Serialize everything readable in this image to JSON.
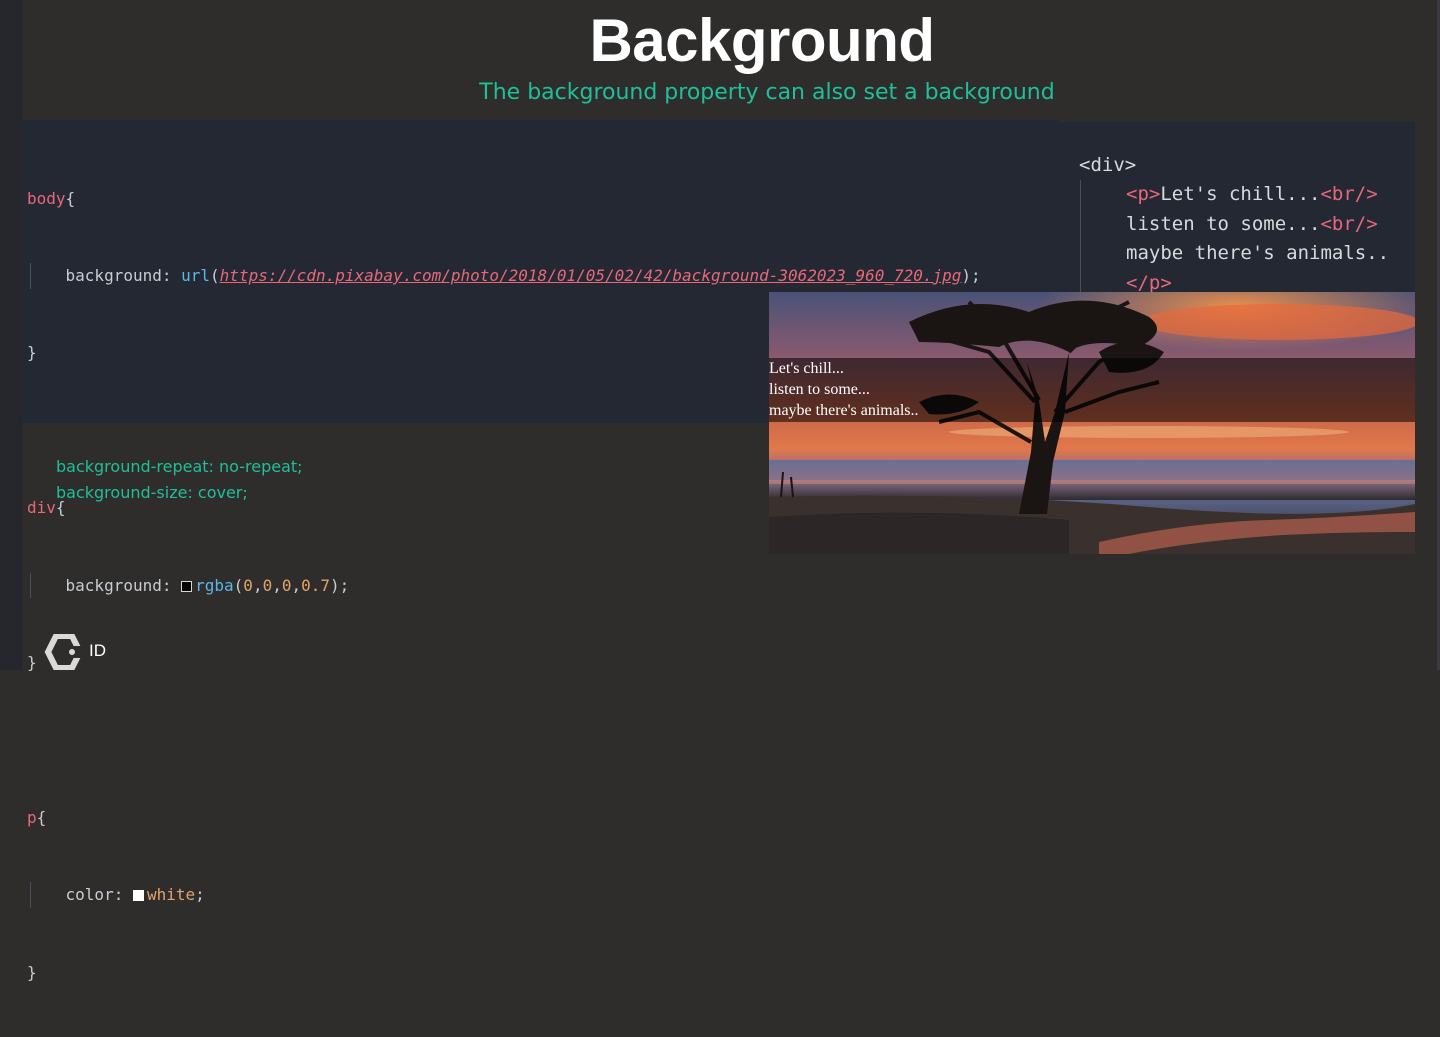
{
  "slide": {
    "title": "Background",
    "subtitle": "The background property can also set a background"
  },
  "css_code": {
    "body_selector": "body",
    "body_prop": "background",
    "body_fn": "url",
    "body_url": "https://cdn.pixabay.com/photo/2018/01/05/02/42/background-3062023_960_720.jpg",
    "div_selector": "div",
    "div_prop": "background",
    "div_fn": "rgba",
    "div_args": [
      "0",
      "0",
      "0",
      "0.7"
    ],
    "p_selector": "p",
    "p_prop": "color",
    "p_value": "white"
  },
  "html_code": {
    "div_open": "<div>",
    "p_open_tag": "<p>",
    "line1": "Let's chill...",
    "br": "<br/>",
    "line2": "listen to some...",
    "line3": "maybe there's animals..",
    "p_close_tag": "</p>"
  },
  "preview": {
    "lines": [
      "Let's chill...",
      "listen to some...",
      "maybe there's animals.."
    ]
  },
  "notes": [
    "background-repeat: no-repeat;",
    "background-size: cover;"
  ],
  "footer": {
    "label": "ID"
  },
  "colors": {
    "background": "#2e2d2c",
    "code_panel": "#232833",
    "accent": "#1fbf9a",
    "selector": "#e8687a",
    "function": "#5bb8e6",
    "number": "#e2a36a"
  },
  "icons": {
    "footer_logo": "logo-icon"
  }
}
